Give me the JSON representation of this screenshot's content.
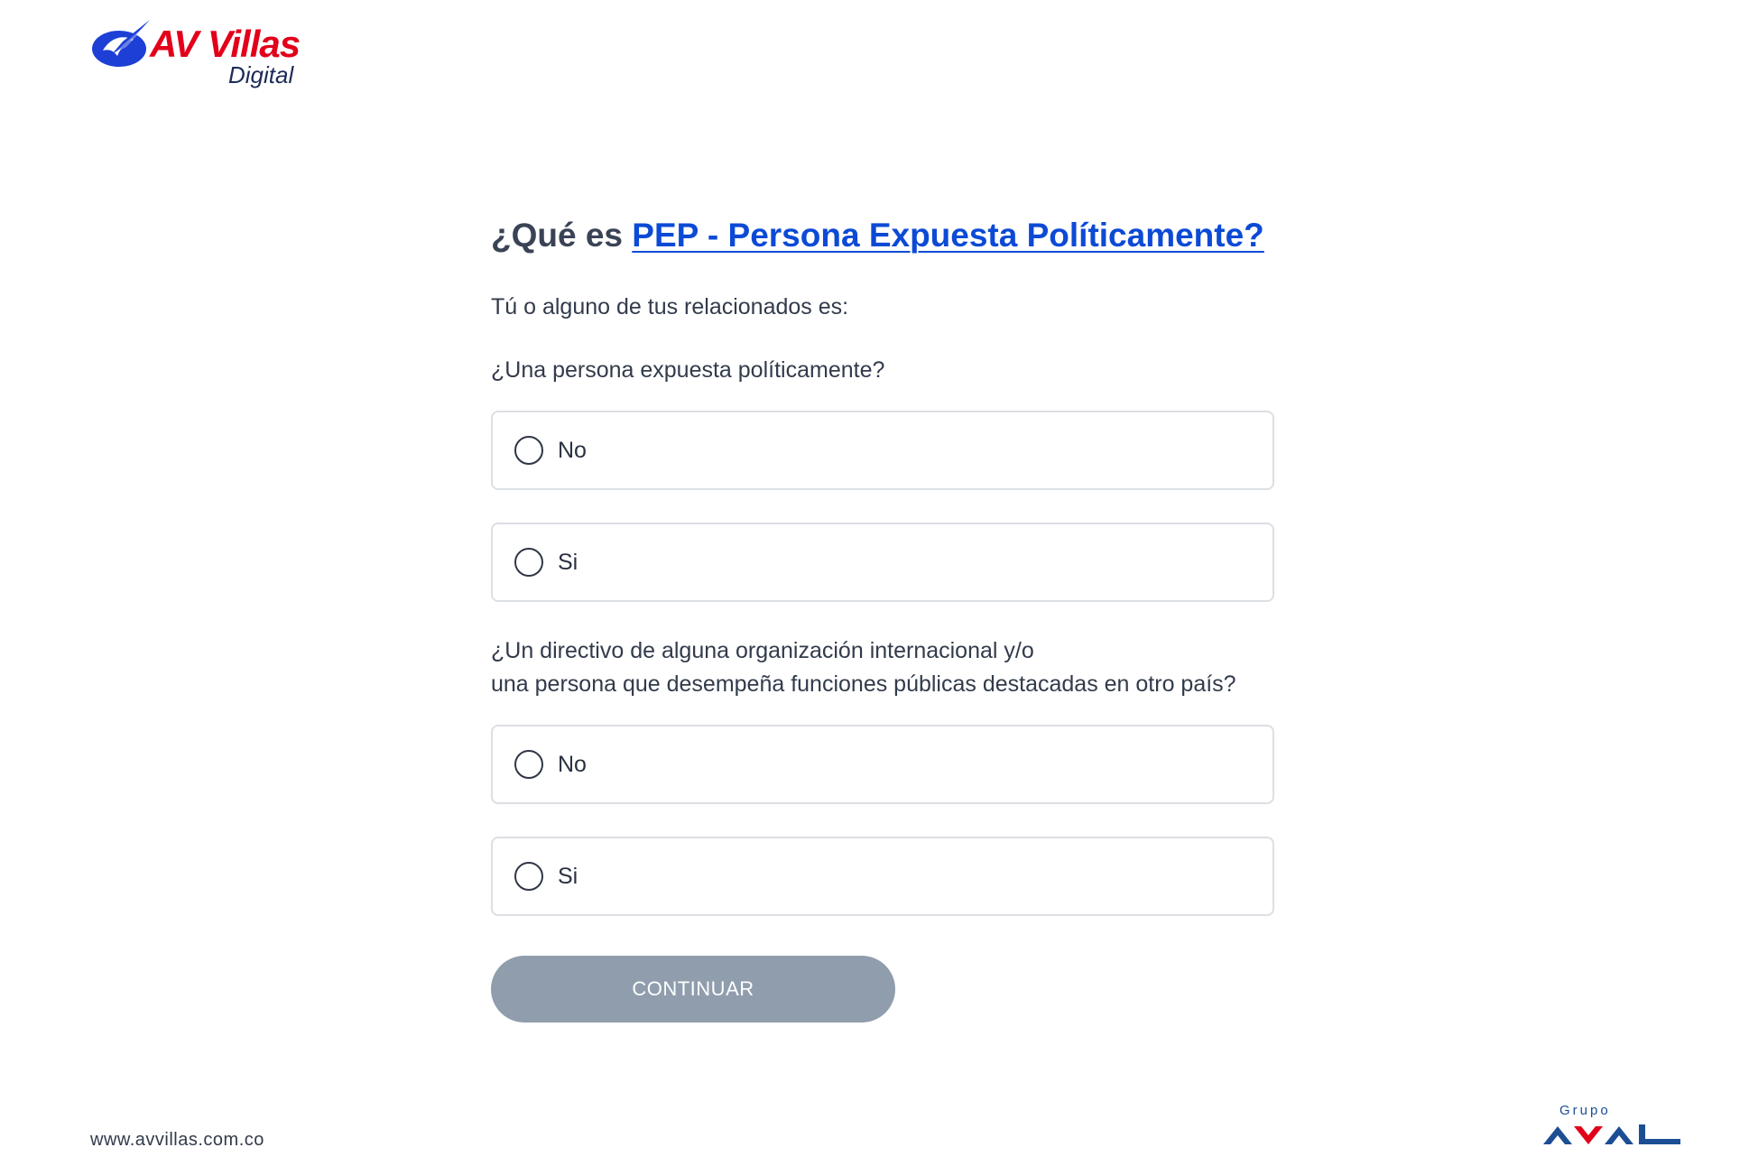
{
  "header": {
    "logo_brand": "AV Villas",
    "logo_sub": "Digital",
    "colors": {
      "brand_red": "#e2001a",
      "brand_blue": "#1d3fd6"
    }
  },
  "main": {
    "title_prefix": "¿Qué es ",
    "title_link": "PEP - Persona Expuesta Políticamente?",
    "intro": "Tú o alguno de tus relacionados es:",
    "question1": "¿Una persona expuesta políticamente?",
    "question1_options": [
      {
        "label": "No",
        "selected": false
      },
      {
        "label": "Si",
        "selected": false
      }
    ],
    "question2_line1": "¿Un directivo de alguna organización internacional y/o",
    "question2_line2": "una persona que desempeña funciones públicas destacadas en otro país?",
    "question2_options": [
      {
        "label": "No",
        "selected": false
      },
      {
        "label": "Si",
        "selected": false
      }
    ],
    "continue_label": "CONTINUAR",
    "continue_disabled": true,
    "colors": {
      "link": "#0c4ad6",
      "button_disabled": "#8f9dad"
    }
  },
  "footer": {
    "url": "www.avvillas.com.co",
    "aval_grupo": "Grupo",
    "aval_brand": "AVAL",
    "colors": {
      "aval_blue": "#1c4e93",
      "aval_red": "#e2001a"
    }
  }
}
